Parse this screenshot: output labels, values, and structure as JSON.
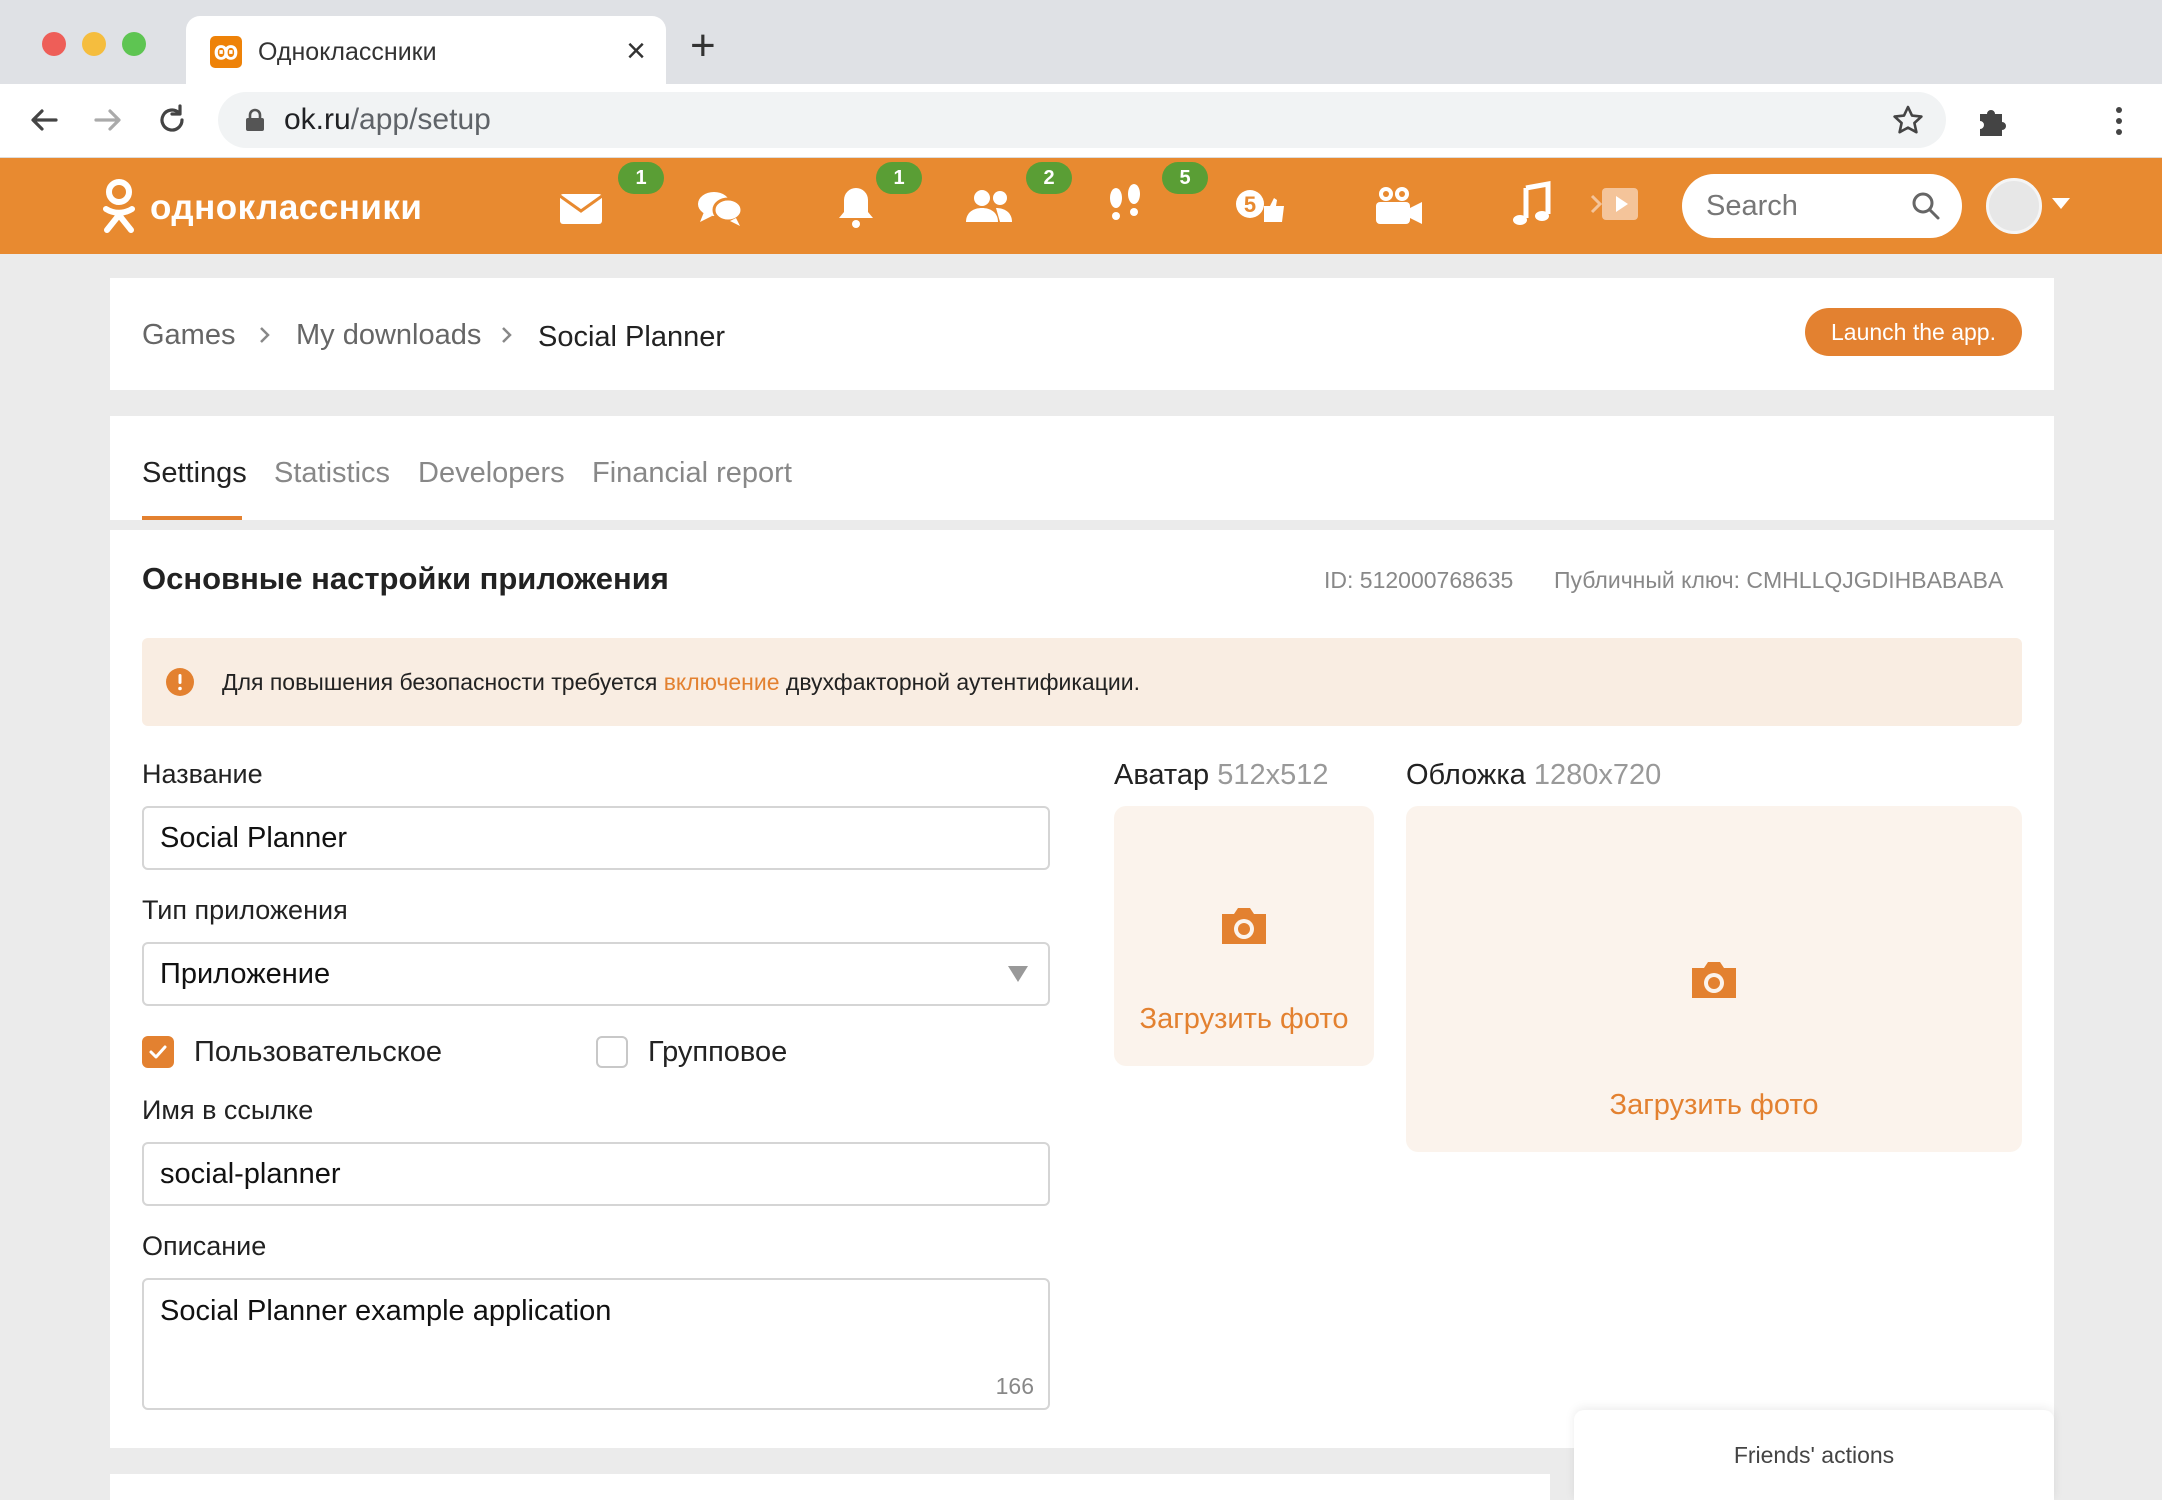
{
  "browser": {
    "tab_title": "Одноклассники",
    "tab_favicon": "ok",
    "url_host": "ok.ru",
    "url_path": "/app/setup"
  },
  "header": {
    "brand": "одноклассники",
    "search_placeholder": "Search",
    "badges": {
      "messages": "1",
      "notifications": "1",
      "friends": "2",
      "guests": "5"
    }
  },
  "breadcrumb": {
    "items": [
      "Games",
      "My downloads",
      "Social Planner"
    ],
    "launch_button": "Launch the app."
  },
  "tabs": [
    "Settings",
    "Statistics",
    "Developers",
    "Financial report"
  ],
  "settings": {
    "title": "Основные настройки приложения",
    "id_label": "ID: 512000768635",
    "public_key_label": "Публичный ключ: CMHLLQJGDIHBABABA",
    "alert": {
      "prefix": "Для повышения безопасности требуется ",
      "link": "включение",
      "suffix": " двухфакторной аутентификации."
    },
    "name_label": "Название",
    "name_value": "Social Planner",
    "type_label": "Тип приложения",
    "type_value": "Приложение",
    "checkbox_user": "Пользовательское",
    "checkbox_user_checked": true,
    "checkbox_group": "Групповое",
    "checkbox_group_checked": false,
    "link_name_label": "Имя в ссылке",
    "link_name_value": "social-planner",
    "description_label": "Описание",
    "description_value": "Social Planner example application",
    "description_counter": "166",
    "avatar_label": "Аватар",
    "avatar_size": "512x512",
    "cover_label": "Обложка",
    "cover_size": "1280x720",
    "upload_label": "Загрузить фото"
  },
  "friends_actions": "Friends' actions",
  "colors": {
    "accent": "#e38130",
    "header": "#e88a30",
    "badge": "#5a9e35"
  }
}
